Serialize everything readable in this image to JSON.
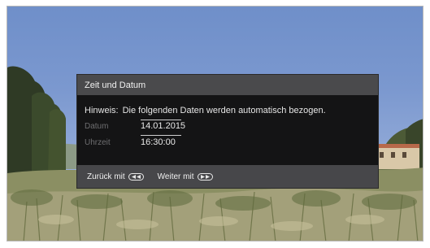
{
  "dialog": {
    "title": "Zeit und Datum",
    "hint_prefix": "Hinweis:",
    "hint_text": "Die folgenden Daten werden automatisch bezogen.",
    "fields": [
      {
        "label": "Datum",
        "value": "14.01.2015"
      },
      {
        "label": "Uhrzeit",
        "value": "16:30:00"
      }
    ],
    "footer": {
      "back_label": "Zurück mit",
      "back_icon": "rewind-key-icon",
      "next_label": "Weiter mit",
      "next_icon": "fast-forward-key-icon"
    }
  },
  "colors": {
    "dialog_header": "#4a4a4c",
    "dialog_body": "#141415",
    "dialog_footer": "#47474a",
    "label_gray": "#6e6e70"
  }
}
